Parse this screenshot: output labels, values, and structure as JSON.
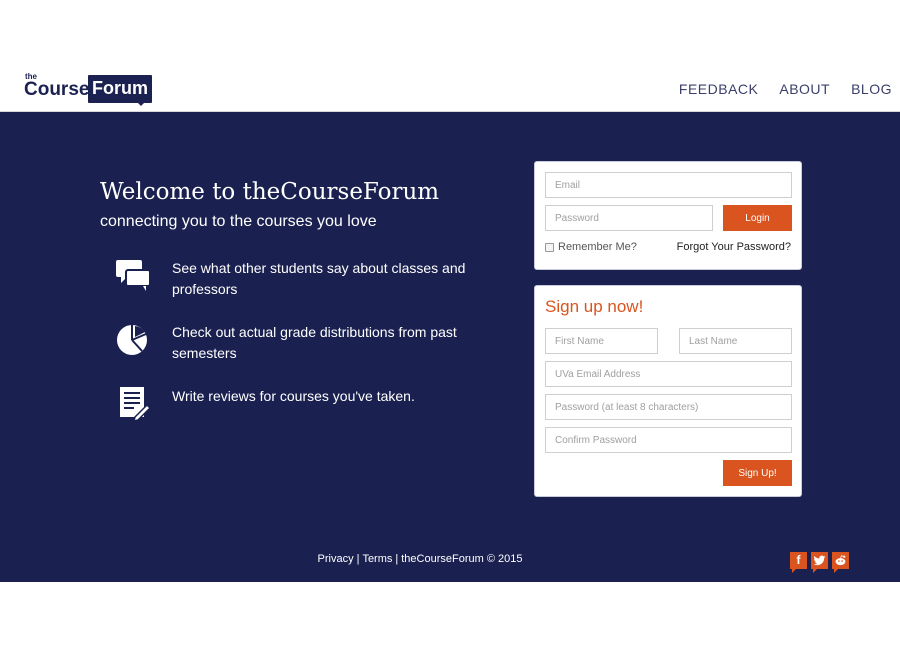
{
  "header": {
    "logo": {
      "the": "the",
      "course": "Course",
      "forum": "Forum"
    },
    "nav": [
      {
        "label": "FEEDBACK"
      },
      {
        "label": "ABOUT"
      },
      {
        "label": "BLOG"
      }
    ]
  },
  "hero": {
    "title": "Welcome to theCourseForum",
    "tagline": "connecting you to the courses you love",
    "features": [
      {
        "icon": "chat-bubbles-icon",
        "text": "See what other students say about classes and professors"
      },
      {
        "icon": "pie-chart-icon",
        "text": "Check out actual grade distributions from past semesters"
      },
      {
        "icon": "review-document-icon",
        "text": "Write reviews for courses you've taken."
      }
    ]
  },
  "login": {
    "email_placeholder": "Email",
    "password_placeholder": "Password",
    "login_label": "Login",
    "remember_label": "Remember Me?",
    "forgot_label": "Forgot Your Password?"
  },
  "signup": {
    "title": "Sign up now!",
    "first_name_placeholder": "First Name",
    "last_name_placeholder": "Last Name",
    "email_placeholder": "UVa Email Address",
    "password_placeholder": "Password (at least 8 characters)",
    "confirm_placeholder": "Confirm Password",
    "submit_label": "Sign Up!"
  },
  "footer": {
    "privacy": "Privacy",
    "terms": "Terms",
    "copyright": "theCourseForum © 2015",
    "separator": "|",
    "social": [
      {
        "icon": "facebook-icon",
        "glyph": "f"
      },
      {
        "icon": "twitter-icon",
        "glyph": "t"
      },
      {
        "icon": "reddit-icon",
        "glyph": "r"
      }
    ]
  },
  "colors": {
    "navy": "#1a2150",
    "accent": "#d9541e",
    "white": "#ffffff"
  }
}
